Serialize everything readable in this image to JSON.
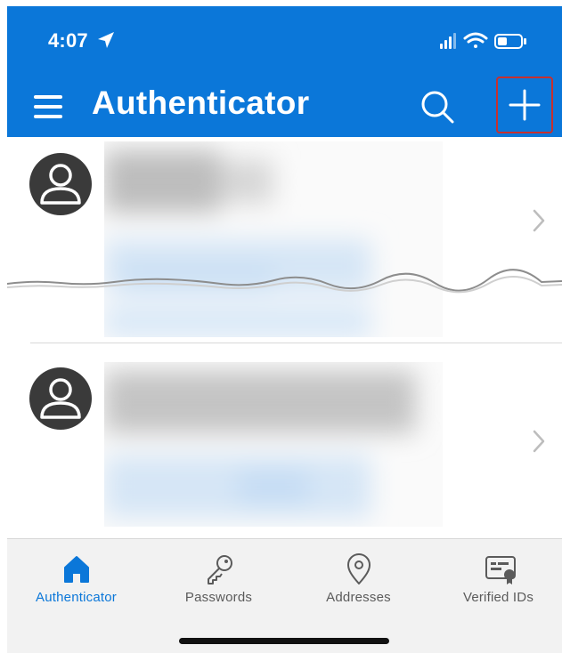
{
  "status_bar": {
    "time": "4:07"
  },
  "header": {
    "title": "Authenticator"
  },
  "accounts": [
    {
      "avatar": "person-icon"
    },
    {
      "avatar": "person-icon"
    }
  ],
  "bottom_nav": {
    "items": [
      {
        "label": "Authenticator",
        "icon": "home-icon",
        "active": true
      },
      {
        "label": "Passwords",
        "icon": "key-icon",
        "active": false
      },
      {
        "label": "Addresses",
        "icon": "location-pin-icon",
        "active": false
      },
      {
        "label": "Verified IDs",
        "icon": "id-card-icon",
        "active": false
      }
    ]
  },
  "colors": {
    "brand_blue": "#0b77d9",
    "highlight_red": "#c6302f",
    "avatar_bg": "#3a3a3a"
  }
}
